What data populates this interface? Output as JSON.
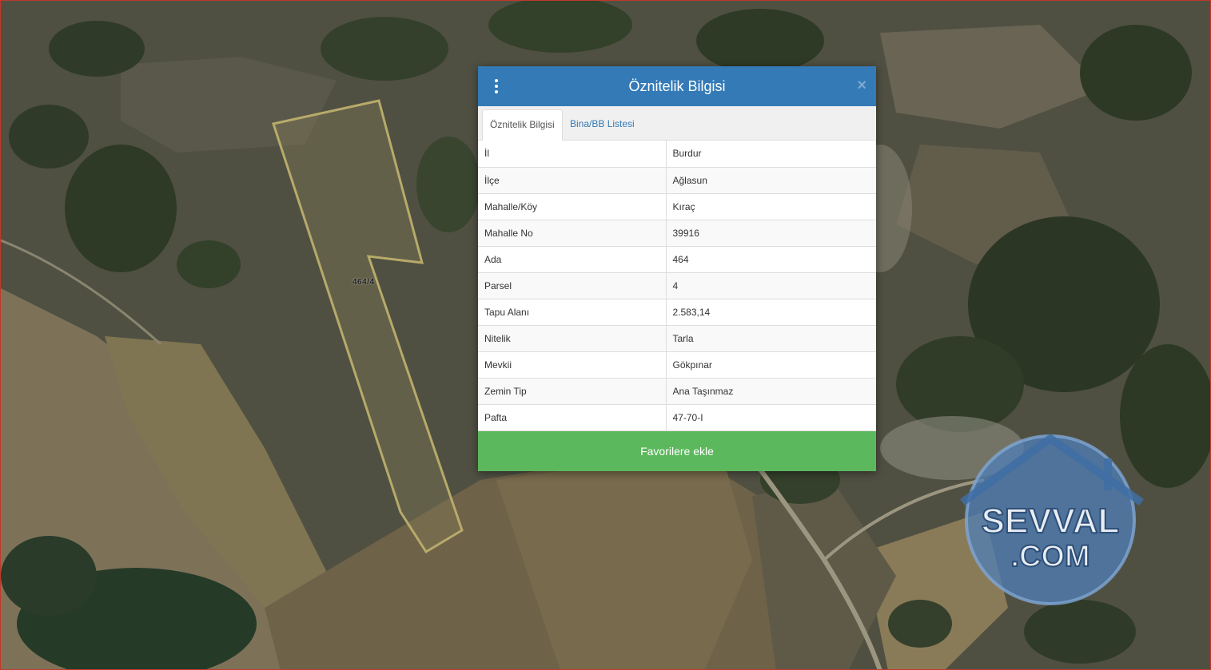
{
  "map": {
    "parcel_label": "464/4",
    "colors": {
      "terrain_dark": "#3d4a2f",
      "field": "#7a6f52",
      "parcel_outline": "#b7aa6a"
    }
  },
  "panel": {
    "title": "Öznitelik Bilgisi",
    "close_glyph": "×",
    "header_color": "#337ab7",
    "tabs": [
      {
        "label": "Öznitelik Bilgisi",
        "active": true
      },
      {
        "label": "Bina/BB Listesi",
        "active": false
      }
    ],
    "rows": [
      {
        "key": "İl",
        "value": "Burdur"
      },
      {
        "key": "İlçe",
        "value": "Ağlasun"
      },
      {
        "key": "Mahalle/Köy",
        "value": "Kıraç"
      },
      {
        "key": "Mahalle No",
        "value": "39916"
      },
      {
        "key": "Ada",
        "value": "464"
      },
      {
        "key": "Parsel",
        "value": "4"
      },
      {
        "key": "Tapu Alanı",
        "value": "2.583,14"
      },
      {
        "key": "Nitelik",
        "value": "Tarla"
      },
      {
        "key": "Mevkii",
        "value": "Gökpınar"
      },
      {
        "key": "Zemin Tip",
        "value": "Ana Taşınmaz"
      },
      {
        "key": "Pafta",
        "value": "47-70-I"
      }
    ],
    "favorite_button": "Favorilere ekle",
    "favorite_color": "#5cb85c"
  },
  "watermark": {
    "line1": "SEVVAL",
    "line2": ".COM"
  }
}
